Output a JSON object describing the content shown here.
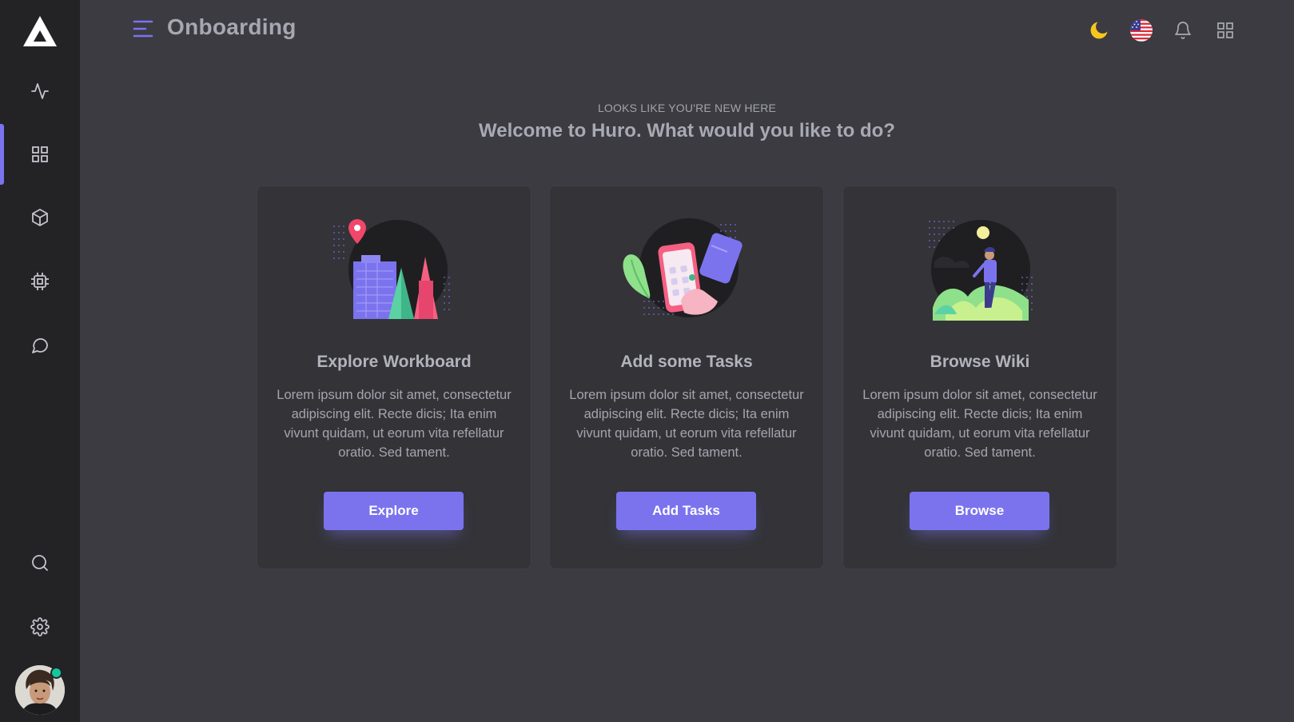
{
  "header": {
    "title": "Onboarding"
  },
  "hero": {
    "kicker": "LOOKS LIKE YOU'RE NEW HERE",
    "title": "Welcome to Huro. What would you like to do?"
  },
  "cards": [
    {
      "title": "Explore Workboard",
      "text": "Lorem ipsum dolor sit amet, consectetur adipiscing elit. Recte dicis; Ita enim vivunt quidam, ut eorum vita refellatur oratio. Sed tament.",
      "button": "Explore"
    },
    {
      "title": "Add some Tasks",
      "text": "Lorem ipsum dolor sit amet, consectetur adipiscing elit. Recte dicis; Ita enim vivunt quidam, ut eorum vita refellatur oratio. Sed tament.",
      "button": "Add Tasks"
    },
    {
      "title": "Browse Wiki",
      "text": "Lorem ipsum dolor sit amet, consectetur adipiscing elit. Recte dicis; Ita enim vivunt quidam, ut eorum vita refellatur oratio. Sed tament.",
      "button": "Browse"
    }
  ],
  "sidebar": {
    "items": [
      {
        "icon": "activity-icon"
      },
      {
        "icon": "grid-icon",
        "active": true
      },
      {
        "icon": "box-icon"
      },
      {
        "icon": "cpu-icon"
      },
      {
        "icon": "message-circle-icon"
      }
    ],
    "bottom": [
      {
        "icon": "search-icon"
      },
      {
        "icon": "settings-icon"
      }
    ],
    "status": "online"
  },
  "topbar_icons": [
    "moon-icon",
    "us-flag-icon",
    "bell-icon",
    "apps-grid-icon"
  ],
  "colors": {
    "accent": "#7b73ee",
    "background": "#3b3b41",
    "sidebar": "#232326",
    "card": "#333338",
    "online": "#12c99b",
    "moon": "#f7c51e"
  }
}
